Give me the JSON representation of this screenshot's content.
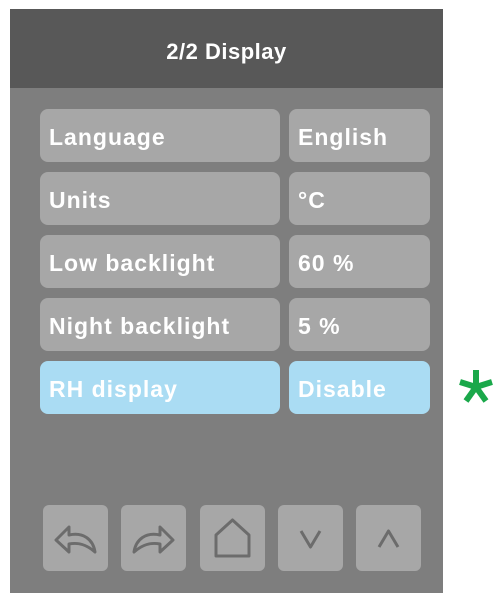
{
  "header": {
    "title": "2/2 Display"
  },
  "settings": [
    {
      "label": "Language",
      "value": "English"
    },
    {
      "label": "Units",
      "value": "°C"
    },
    {
      "label": "Low backlight",
      "value": "60 %"
    },
    {
      "label": "Night backlight",
      "value": "5 %"
    },
    {
      "label": "RH display",
      "value": "Disable",
      "selected": true
    }
  ],
  "nav_buttons": [
    {
      "icon": "undo-icon"
    },
    {
      "icon": "redo-icon"
    },
    {
      "icon": "home-icon"
    },
    {
      "icon": "chevron-down-icon"
    },
    {
      "icon": "chevron-up-icon"
    }
  ],
  "colors": {
    "header_bg": "#585858",
    "panel_bg": "#7e7e7e",
    "cell_bg": "#a7a7a7",
    "selected_bg": "#aadcf3",
    "star": "#1aa84a"
  },
  "marker": {
    "icon": "star-icon"
  }
}
